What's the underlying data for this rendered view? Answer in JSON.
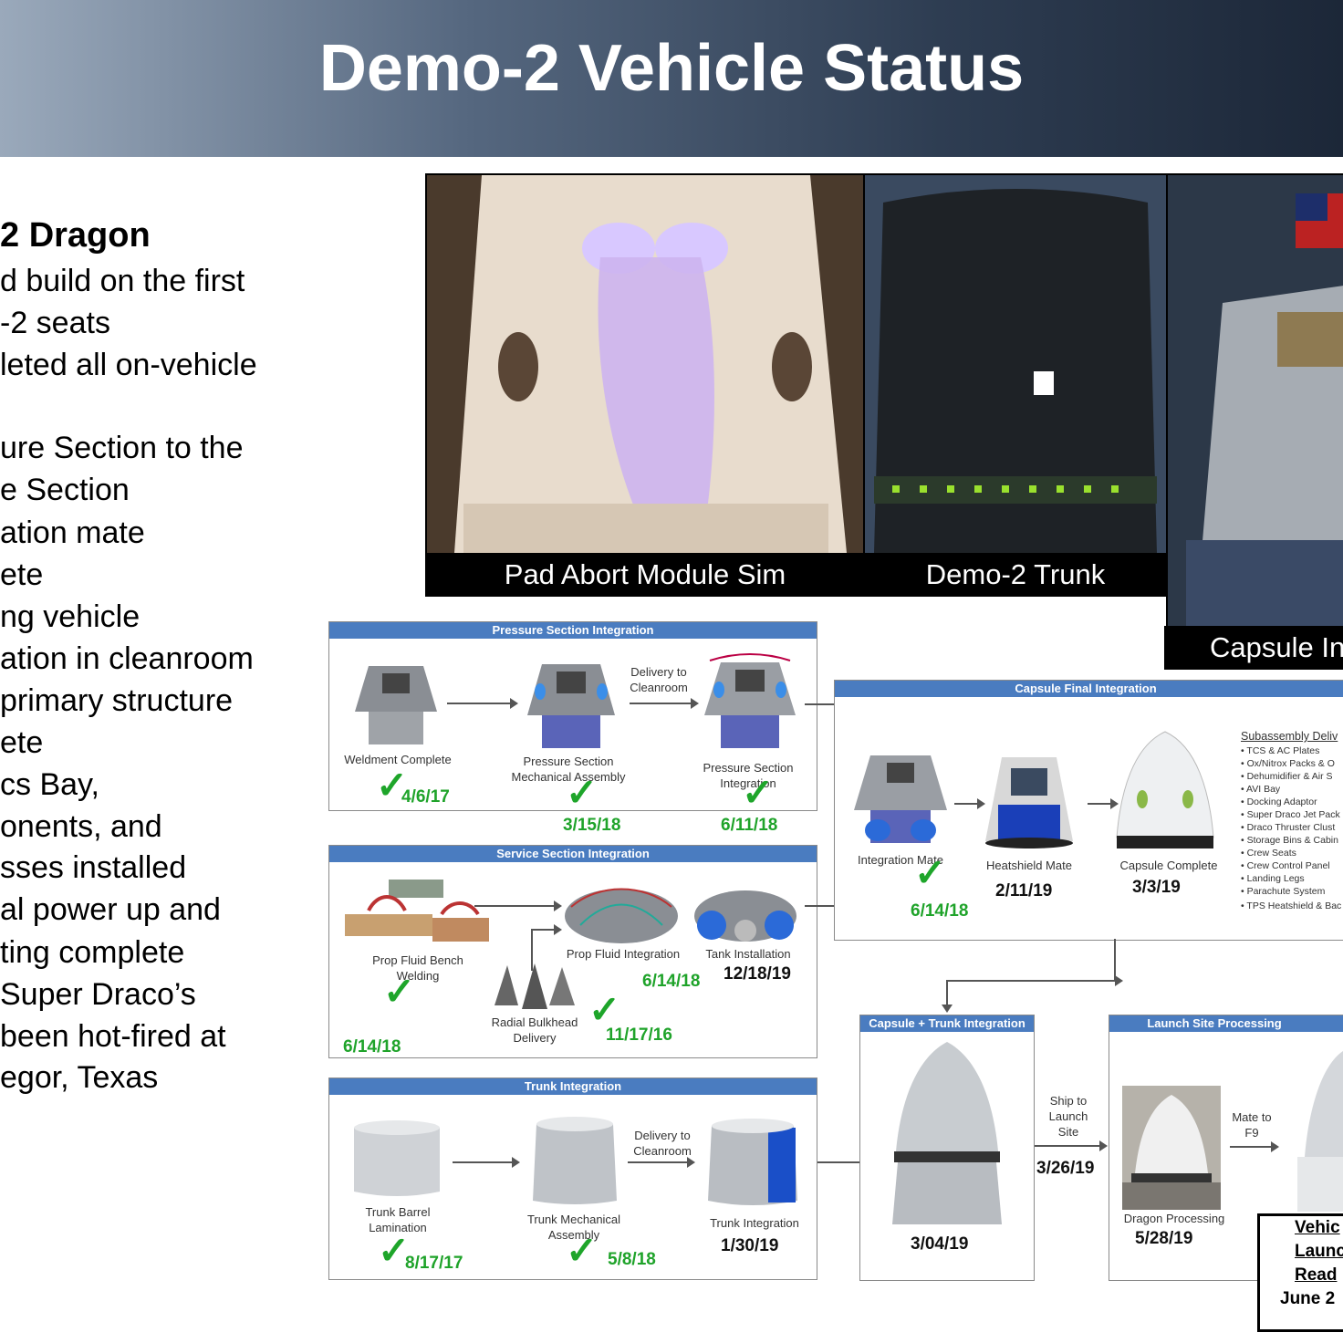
{
  "title": "Demo-2 Vehicle Status",
  "bullets": [
    "2 Dragon",
    "d build on the first",
    "-2 seats",
    "leted all on-vehicle",
    "ure Section to the",
    "e Section",
    "ation mate",
    "ete",
    "ng vehicle",
    "ation in cleanroom",
    "primary structure",
    "ete",
    "cs Bay,",
    "onents, and",
    "sses installed",
    "al power up and",
    "ting complete",
    "Super Draco’s",
    "been hot-fired at",
    "egor, Texas"
  ],
  "photos": {
    "pad_abort": "Pad Abort Module Sim",
    "trunk": "Demo-2 Trunk",
    "capsule": "Capsule In"
  },
  "pressure": {
    "title": "Pressure Section Integration",
    "weldment": "Weldment Complete",
    "weldment_date": "4/6/17",
    "delivery": "Delivery to Cleanroom",
    "mech": "Pressure Section Mechanical Assembly",
    "mech_date": "3/15/18",
    "integ": "Pressure Section Integration",
    "integ_date": "6/11/18"
  },
  "service": {
    "title": "Service Section Integration",
    "bench": "Prop Fluid Bench Welding",
    "bench_date": "6/14/18",
    "fluid": "Prop Fluid Integration",
    "fluid_date": "6/14/18",
    "tank": "Tank Installation",
    "tank_date": "12/18/19",
    "bulkhead": "Radial Bulkhead Delivery",
    "bulkhead_date": "11/17/16"
  },
  "trunk": {
    "title": "Trunk Integration",
    "barrel": "Trunk Barrel Lamination",
    "barrel_date": "8/17/17",
    "delivery": "Delivery to Cleanroom",
    "mech": "Trunk Mechanical Assembly",
    "mech_date": "5/8/18",
    "integ": "Trunk Integration",
    "integ_date": "1/30/19"
  },
  "final": {
    "title": "Capsule Final Integration",
    "mate": "Integration Mate",
    "mate_date": "6/14/18",
    "heat": "Heatshield Mate",
    "heat_date": "2/11/19",
    "complete": "Capsule Complete",
    "complete_date": "3/3/19",
    "sub_title": "Subassembly Deliv",
    "sub_items": [
      "• TCS & AC Plates",
      "• Ox/Nitrox Packs & O",
      "• Dehumidifier & Air S",
      "• AVI Bay",
      "• Docking Adaptor",
      "• Super Draco Jet Pack",
      "• Draco Thruster Clust",
      "• Storage Bins & Cabin",
      "• Crew Seats",
      "• Crew Control Panel",
      "• Landing Legs",
      "• Parachute System",
      "• TPS Heatshield & Bac"
    ]
  },
  "ct": {
    "title": "Capsule + Trunk Integration",
    "date": "3/04/19",
    "ship": "Ship to Launch Site",
    "ship_date": "3/26/19"
  },
  "launch": {
    "title": "Launch Site Processing",
    "proc": "Dragon Processing",
    "proc_date": "5/28/19",
    "mate": "Mate to F9",
    "ready1": "Vehic",
    "ready2": "Launc",
    "ready3": "Read",
    "ready_date": "June 2"
  },
  "colors": {
    "check": "#1ea52a",
    "panel_header": "#4a7cc0"
  }
}
